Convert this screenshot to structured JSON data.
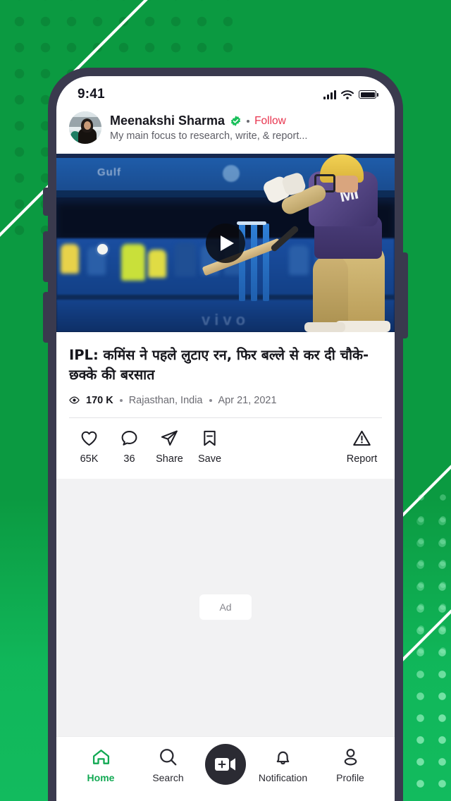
{
  "background": {
    "green": "#0b9a41",
    "green_bright": "#12bb5e",
    "dot_dark": "#0a8939",
    "dot_light": "#96f0be",
    "accent_line": "#ffffff"
  },
  "phone": {
    "frame_color": "#3a3a4e",
    "buttons": [
      "mute-switch",
      "volume-up",
      "volume-down",
      "power"
    ]
  },
  "status_bar": {
    "time": "9:41",
    "signal_icon": "cellular-signal-icon",
    "wifi_icon": "wifi-icon",
    "battery_icon": "battery-full-icon"
  },
  "author": {
    "avatar_alt": "avatar",
    "name": "Meenakshi Sharma",
    "verified_icon": "verified-badge-icon",
    "separator": "•",
    "follow_label": "Follow",
    "follow_color": "#e8344e",
    "bio": "My main focus to research, write, & report..."
  },
  "video": {
    "play_icon": "play-icon",
    "banner_text": "Gulf",
    "sponsor_text": "vivo",
    "jersey_text": "MI"
  },
  "post": {
    "headline": "IPL: कमिंस ने पहले लुटाए रन, फिर बल्ले से कर दी चौके-छक्के की बरसात",
    "views_icon": "eye-icon",
    "views": "170 K",
    "dot1": "•",
    "location": "Rajasthan, India",
    "dot2": "•",
    "date": "Apr 21, 2021"
  },
  "actions": [
    {
      "icon": "heart-icon",
      "label": "65K"
    },
    {
      "icon": "comment-icon",
      "label": "36"
    },
    {
      "icon": "share-icon",
      "label": "Share"
    },
    {
      "icon": "bookmark-icon",
      "label": "Save"
    }
  ],
  "report": {
    "icon": "warning-triangle-icon",
    "label": "Report"
  },
  "ad": {
    "label": "Ad"
  },
  "bottom_nav": {
    "active_color": "#12a953",
    "items": [
      {
        "icon": "home-icon",
        "label": "Home",
        "active": true
      },
      {
        "icon": "search-icon",
        "label": "Search",
        "active": false
      },
      {
        "icon": "notification-icon",
        "label": "Notification",
        "active": false
      },
      {
        "icon": "profile-icon",
        "label": "Profile",
        "active": false
      }
    ],
    "fab": {
      "icon": "add-video-icon"
    }
  }
}
